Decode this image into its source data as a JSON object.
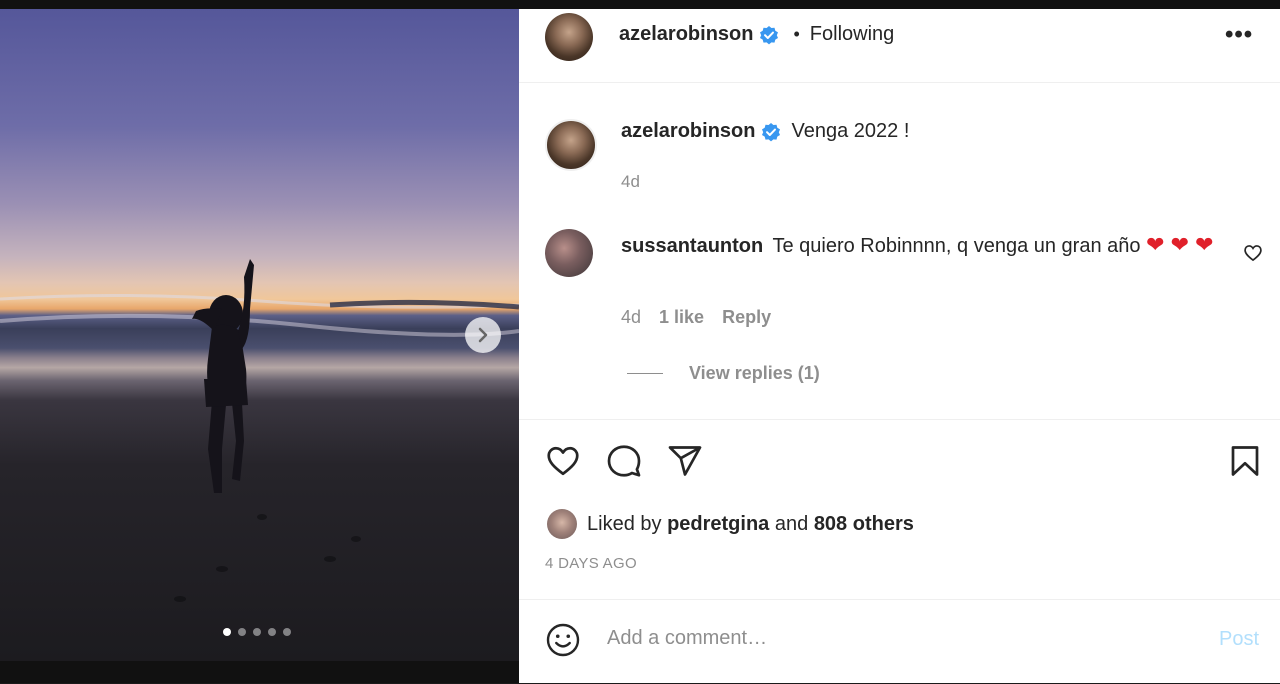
{
  "post": {
    "author": "azelarobinson",
    "follow_status": "Following",
    "separator": "•",
    "more_label": "•••",
    "caption_text": "Venga 2022 !",
    "caption_time": "4d",
    "carousel": {
      "total_slides": 5,
      "active_index": 0
    }
  },
  "comment": {
    "username": "sussantaunton",
    "text": "Te quiero Robinnnn, q venga un gran año",
    "emojis": "❤ ❤ ❤",
    "time": "4d",
    "likes": "1 like",
    "reply_label": "Reply",
    "view_replies": "View replies (1)"
  },
  "likes": {
    "prefix": "Liked by",
    "user": "pedretgina",
    "conjunction": "and",
    "others": "808 others"
  },
  "posted_ago": "4 DAYS AGO",
  "add_comment": {
    "placeholder": "Add a comment…",
    "post_label": "Post"
  },
  "colors": {
    "verified": "#3897f0",
    "post_disabled": "#b2dffc",
    "secondary_text": "#8e8e8e"
  }
}
